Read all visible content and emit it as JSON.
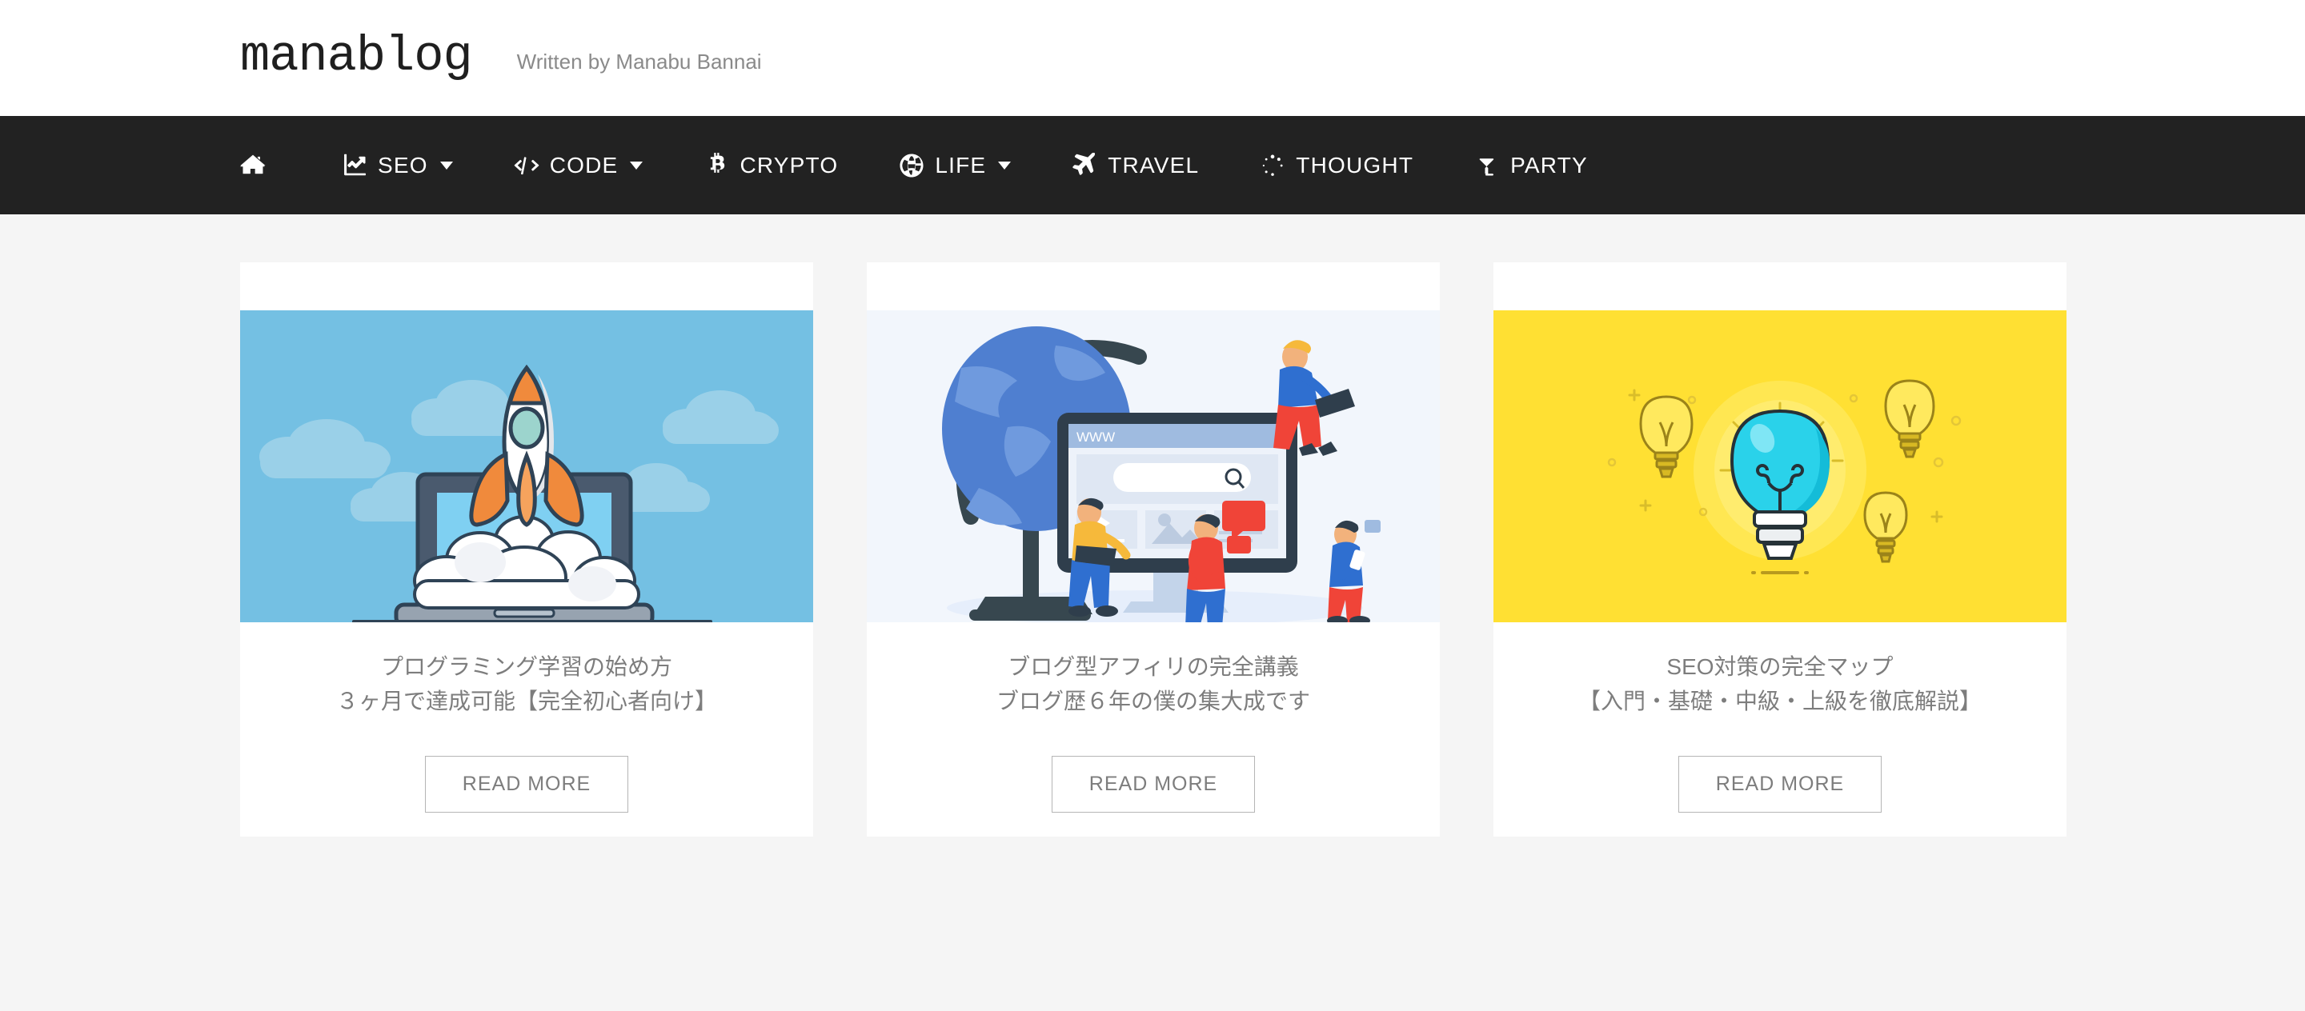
{
  "header": {
    "logo": "manablog",
    "byline": "Written by Manabu Bannai"
  },
  "nav": {
    "items": [
      {
        "label": "",
        "icon": "home-icon",
        "caret": false
      },
      {
        "label": "SEO",
        "icon": "chart-line-icon",
        "caret": true
      },
      {
        "label": "CODE",
        "icon": "code-icon",
        "caret": true
      },
      {
        "label": "CRYPTO",
        "icon": "bitcoin-icon",
        "caret": false
      },
      {
        "label": "LIFE",
        "icon": "globe-icon",
        "caret": true
      },
      {
        "label": "TRAVEL",
        "icon": "plane-icon",
        "caret": false
      },
      {
        "label": "THOUGHT",
        "icon": "circle-notch-icon",
        "caret": false
      },
      {
        "label": "PARTY",
        "icon": "cocktail-icon",
        "caret": false
      }
    ]
  },
  "cards": [
    {
      "title_line1": "プログラミング学習の始め方",
      "title_line2": "３ヶ月で達成可能【完全初心者向け】",
      "button": "READ MORE",
      "image": "rocket-laptop-illustration",
      "image_bg": "#74c0e3"
    },
    {
      "title_line1": "ブログ型アフィリの完全講義",
      "title_line2": "ブログ歴６年の僕の集大成です",
      "button": "READ MORE",
      "image": "globe-monitor-illustration",
      "image_bg": "#f2f6fc",
      "screen_label": "WWW"
    },
    {
      "title_line1": "SEO対策の完全マップ",
      "title_line2": "【入門・基礎・中級・上級を徹底解説】",
      "button": "READ MORE",
      "image": "lightbulb-illustration",
      "image_bg": "#ffe033"
    }
  ],
  "colors": {
    "page_bg": "#f5f5f5",
    "nav_bg": "#222222",
    "card_bg": "#ffffff",
    "title_text": "#7d7d7d",
    "byline_text": "#8a8a8a"
  }
}
